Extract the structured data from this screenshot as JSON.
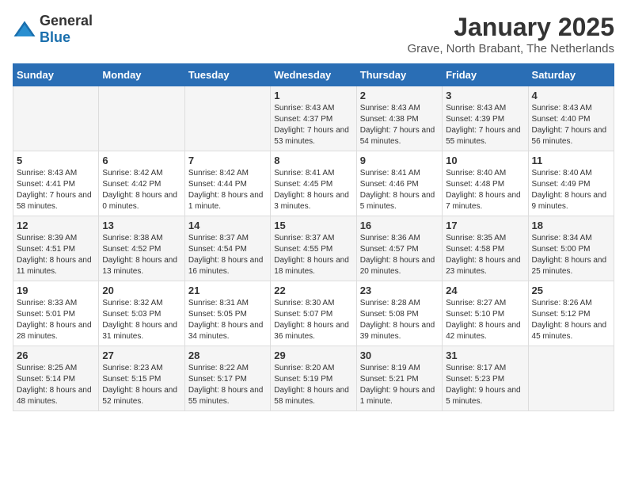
{
  "header": {
    "logo_general": "General",
    "logo_blue": "Blue",
    "title": "January 2025",
    "subtitle": "Grave, North Brabant, The Netherlands"
  },
  "days_of_week": [
    "Sunday",
    "Monday",
    "Tuesday",
    "Wednesday",
    "Thursday",
    "Friday",
    "Saturday"
  ],
  "weeks": [
    {
      "days": [
        {
          "num": "",
          "info": ""
        },
        {
          "num": "",
          "info": ""
        },
        {
          "num": "",
          "info": ""
        },
        {
          "num": "1",
          "info": "Sunrise: 8:43 AM\nSunset: 4:37 PM\nDaylight: 7 hours and 53 minutes."
        },
        {
          "num": "2",
          "info": "Sunrise: 8:43 AM\nSunset: 4:38 PM\nDaylight: 7 hours and 54 minutes."
        },
        {
          "num": "3",
          "info": "Sunrise: 8:43 AM\nSunset: 4:39 PM\nDaylight: 7 hours and 55 minutes."
        },
        {
          "num": "4",
          "info": "Sunrise: 8:43 AM\nSunset: 4:40 PM\nDaylight: 7 hours and 56 minutes."
        }
      ]
    },
    {
      "days": [
        {
          "num": "5",
          "info": "Sunrise: 8:43 AM\nSunset: 4:41 PM\nDaylight: 7 hours and 58 minutes."
        },
        {
          "num": "6",
          "info": "Sunrise: 8:42 AM\nSunset: 4:42 PM\nDaylight: 8 hours and 0 minutes."
        },
        {
          "num": "7",
          "info": "Sunrise: 8:42 AM\nSunset: 4:44 PM\nDaylight: 8 hours and 1 minute."
        },
        {
          "num": "8",
          "info": "Sunrise: 8:41 AM\nSunset: 4:45 PM\nDaylight: 8 hours and 3 minutes."
        },
        {
          "num": "9",
          "info": "Sunrise: 8:41 AM\nSunset: 4:46 PM\nDaylight: 8 hours and 5 minutes."
        },
        {
          "num": "10",
          "info": "Sunrise: 8:40 AM\nSunset: 4:48 PM\nDaylight: 8 hours and 7 minutes."
        },
        {
          "num": "11",
          "info": "Sunrise: 8:40 AM\nSunset: 4:49 PM\nDaylight: 8 hours and 9 minutes."
        }
      ]
    },
    {
      "days": [
        {
          "num": "12",
          "info": "Sunrise: 8:39 AM\nSunset: 4:51 PM\nDaylight: 8 hours and 11 minutes."
        },
        {
          "num": "13",
          "info": "Sunrise: 8:38 AM\nSunset: 4:52 PM\nDaylight: 8 hours and 13 minutes."
        },
        {
          "num": "14",
          "info": "Sunrise: 8:37 AM\nSunset: 4:54 PM\nDaylight: 8 hours and 16 minutes."
        },
        {
          "num": "15",
          "info": "Sunrise: 8:37 AM\nSunset: 4:55 PM\nDaylight: 8 hours and 18 minutes."
        },
        {
          "num": "16",
          "info": "Sunrise: 8:36 AM\nSunset: 4:57 PM\nDaylight: 8 hours and 20 minutes."
        },
        {
          "num": "17",
          "info": "Sunrise: 8:35 AM\nSunset: 4:58 PM\nDaylight: 8 hours and 23 minutes."
        },
        {
          "num": "18",
          "info": "Sunrise: 8:34 AM\nSunset: 5:00 PM\nDaylight: 8 hours and 25 minutes."
        }
      ]
    },
    {
      "days": [
        {
          "num": "19",
          "info": "Sunrise: 8:33 AM\nSunset: 5:01 PM\nDaylight: 8 hours and 28 minutes."
        },
        {
          "num": "20",
          "info": "Sunrise: 8:32 AM\nSunset: 5:03 PM\nDaylight: 8 hours and 31 minutes."
        },
        {
          "num": "21",
          "info": "Sunrise: 8:31 AM\nSunset: 5:05 PM\nDaylight: 8 hours and 34 minutes."
        },
        {
          "num": "22",
          "info": "Sunrise: 8:30 AM\nSunset: 5:07 PM\nDaylight: 8 hours and 36 minutes."
        },
        {
          "num": "23",
          "info": "Sunrise: 8:28 AM\nSunset: 5:08 PM\nDaylight: 8 hours and 39 minutes."
        },
        {
          "num": "24",
          "info": "Sunrise: 8:27 AM\nSunset: 5:10 PM\nDaylight: 8 hours and 42 minutes."
        },
        {
          "num": "25",
          "info": "Sunrise: 8:26 AM\nSunset: 5:12 PM\nDaylight: 8 hours and 45 minutes."
        }
      ]
    },
    {
      "days": [
        {
          "num": "26",
          "info": "Sunrise: 8:25 AM\nSunset: 5:14 PM\nDaylight: 8 hours and 48 minutes."
        },
        {
          "num": "27",
          "info": "Sunrise: 8:23 AM\nSunset: 5:15 PM\nDaylight: 8 hours and 52 minutes."
        },
        {
          "num": "28",
          "info": "Sunrise: 8:22 AM\nSunset: 5:17 PM\nDaylight: 8 hours and 55 minutes."
        },
        {
          "num": "29",
          "info": "Sunrise: 8:20 AM\nSunset: 5:19 PM\nDaylight: 8 hours and 58 minutes."
        },
        {
          "num": "30",
          "info": "Sunrise: 8:19 AM\nSunset: 5:21 PM\nDaylight: 9 hours and 1 minute."
        },
        {
          "num": "31",
          "info": "Sunrise: 8:17 AM\nSunset: 5:23 PM\nDaylight: 9 hours and 5 minutes."
        },
        {
          "num": "",
          "info": ""
        }
      ]
    }
  ]
}
